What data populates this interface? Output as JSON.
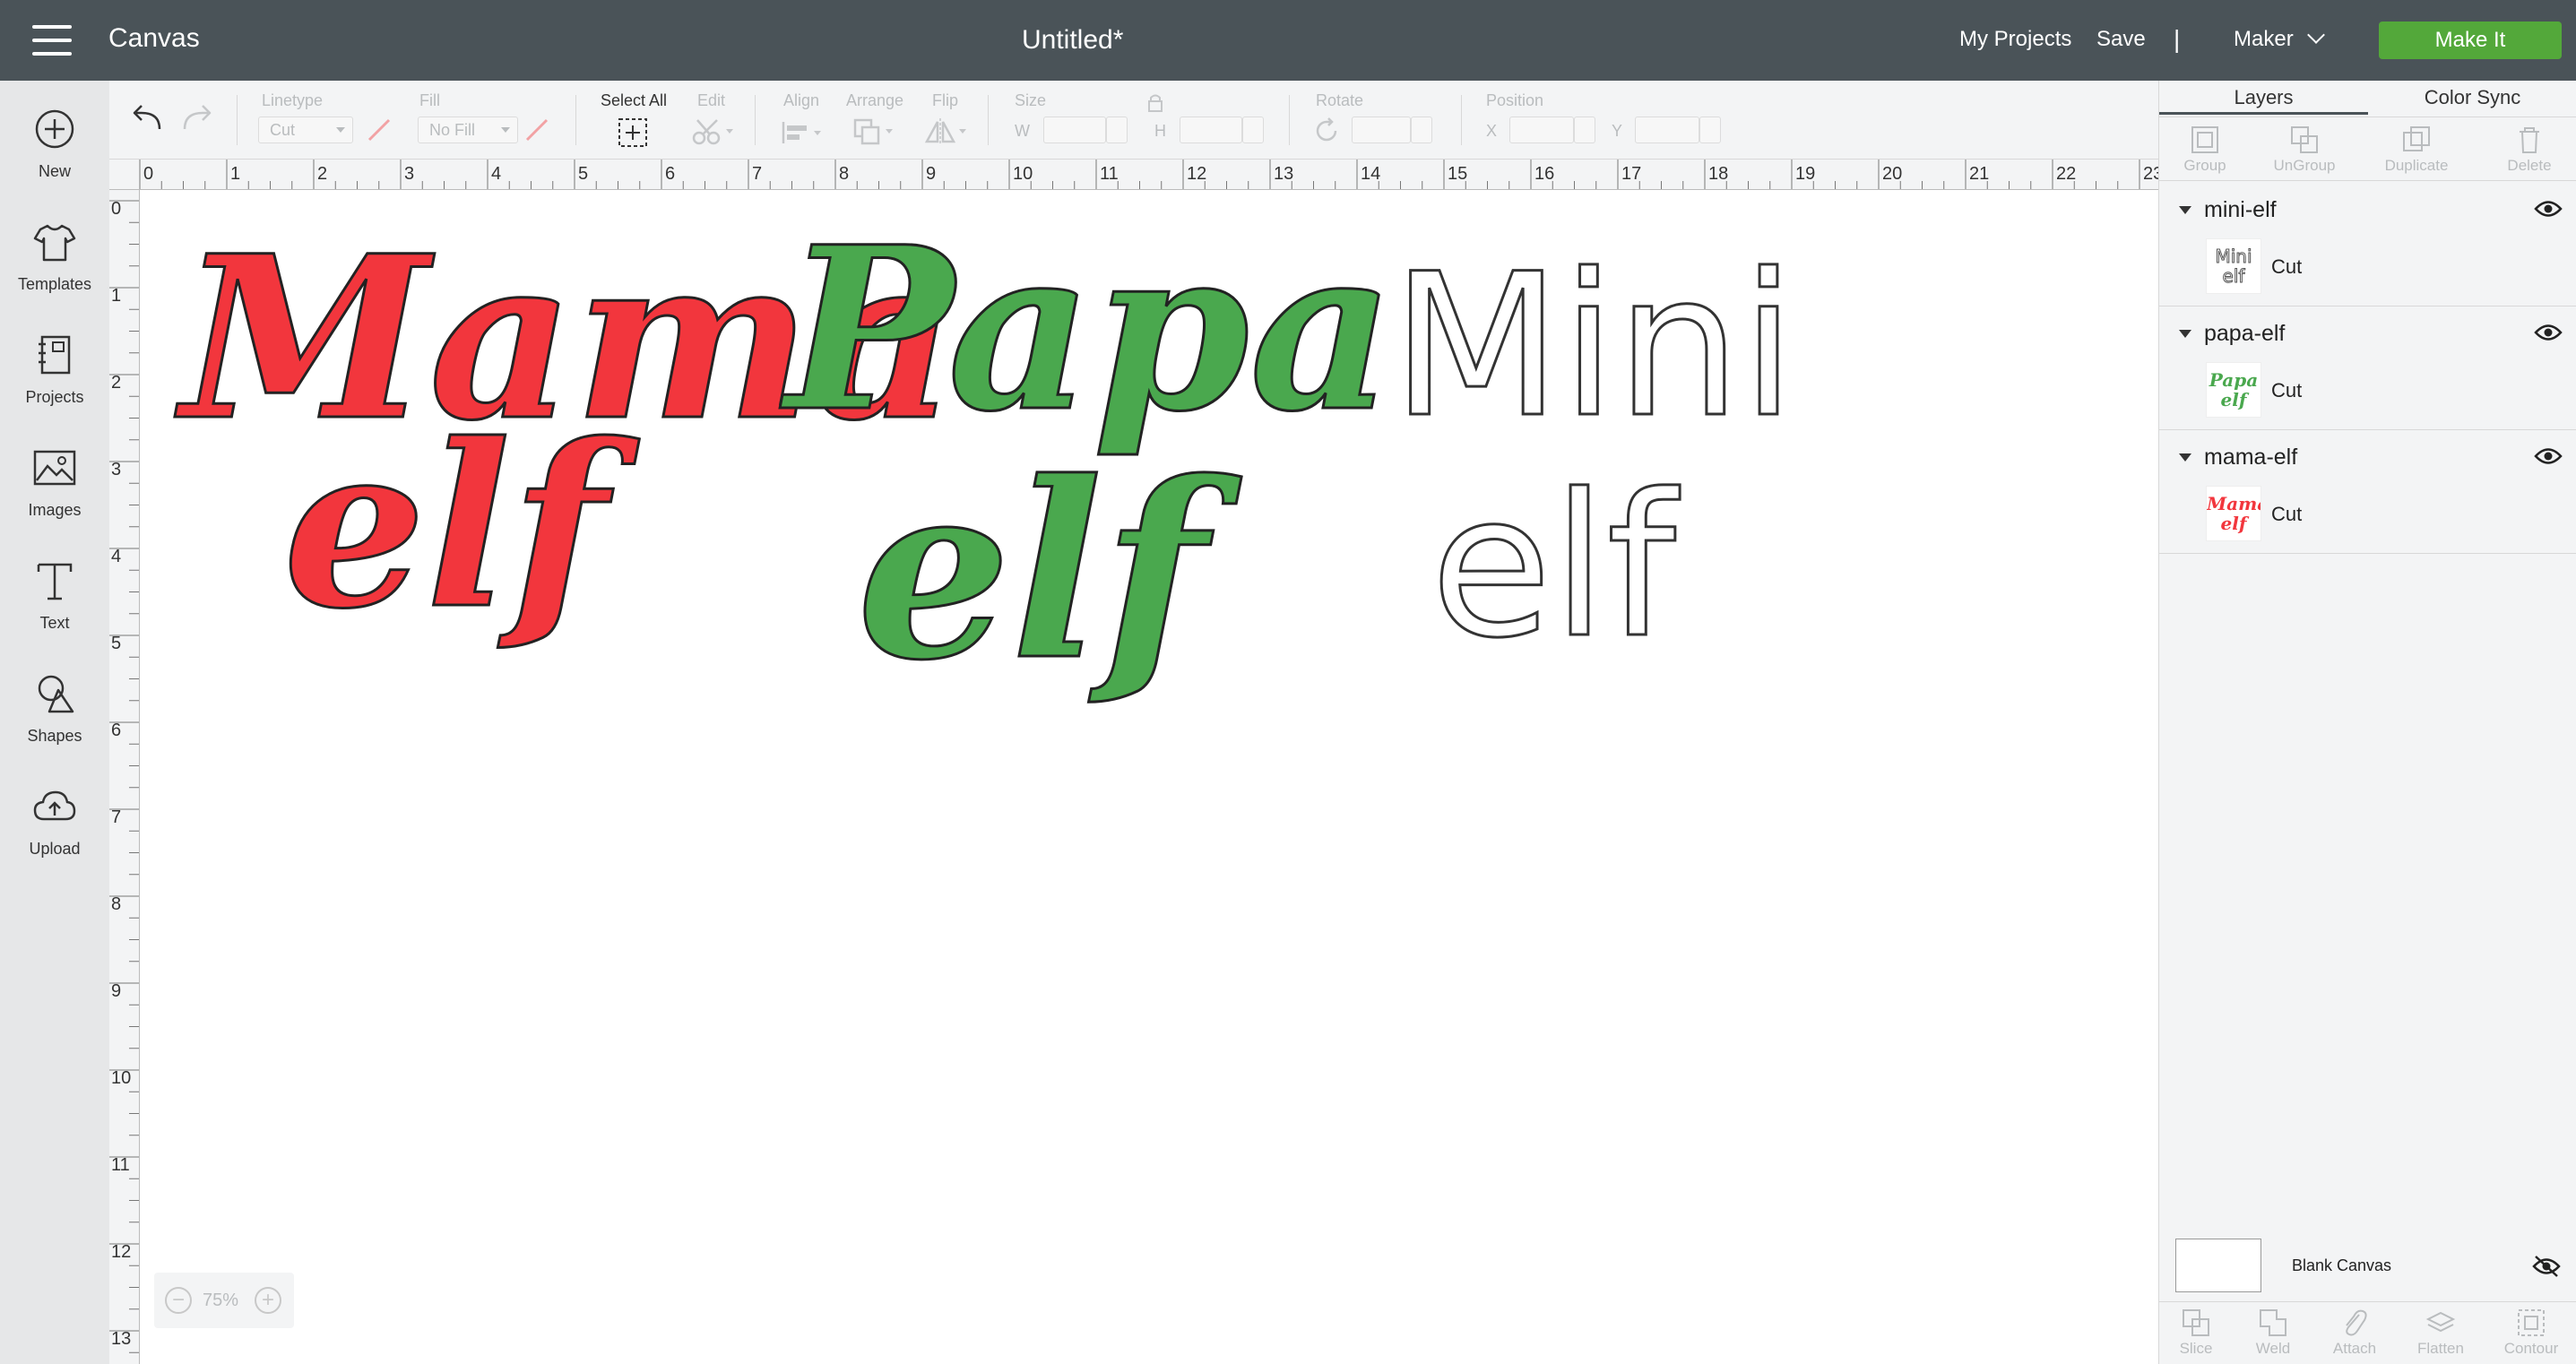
{
  "header": {
    "app_title": "Canvas",
    "doc_title": "Untitled*",
    "my_projects": "My Projects",
    "save": "Save",
    "separator": "|",
    "machine": "Maker",
    "make_it": "Make It"
  },
  "leftnav": {
    "items": [
      {
        "label": "New",
        "icon": "plus-circle-icon"
      },
      {
        "label": "Templates",
        "icon": "tshirt-icon"
      },
      {
        "label": "Projects",
        "icon": "notebook-icon"
      },
      {
        "label": "Images",
        "icon": "image-icon"
      },
      {
        "label": "Text",
        "icon": "text-t-icon"
      },
      {
        "label": "Shapes",
        "icon": "shapes-icon"
      },
      {
        "label": "Upload",
        "icon": "cloud-upload-icon"
      }
    ]
  },
  "toolbar": {
    "linetype_label": "Linetype",
    "linetype_value": "Cut",
    "fill_label": "Fill",
    "fill_value": "No Fill",
    "select_all_label": "Select All",
    "edit_label": "Edit",
    "align_label": "Align",
    "arrange_label": "Arrange",
    "flip_label": "Flip",
    "size_label": "Size",
    "w_label": "W",
    "h_label": "H",
    "rotate_label": "Rotate",
    "position_label": "Position",
    "x_label": "X",
    "y_label": "Y"
  },
  "ruler": {
    "top": [
      "0",
      "1",
      "2",
      "3",
      "4",
      "5",
      "6",
      "7",
      "8",
      "9",
      "10",
      "11",
      "12",
      "13",
      "14",
      "15",
      "16",
      "17",
      "18",
      "19",
      "20",
      "21",
      "22",
      "23"
    ],
    "left": [
      "0",
      "1",
      "2",
      "3",
      "4",
      "5",
      "6",
      "7",
      "8",
      "9",
      "10",
      "11",
      "12",
      "13"
    ]
  },
  "canvas": {
    "designs": {
      "mama_line1": "Mama",
      "mama_line2": "elf",
      "papa_line1": "Papa",
      "papa_line2": "elf",
      "mini_line1": "Mini",
      "mini_line2": "elf"
    },
    "colors": {
      "red": "#f2363d",
      "green": "#4aa84e",
      "outline": "#333333"
    },
    "zoom": {
      "minus": "−",
      "value": "75%",
      "plus": "+"
    }
  },
  "rpanel": {
    "tabs": [
      "Layers",
      "Color Sync"
    ],
    "actions": [
      "Group",
      "UnGroup",
      "Duplicate",
      "Delete"
    ],
    "layers": [
      {
        "name": "mini-elf",
        "operation": "Cut",
        "thumb_line1": "Mini",
        "thumb_line2": "elf",
        "thumb_color": "#ffffff"
      },
      {
        "name": "papa-elf",
        "operation": "Cut",
        "thumb_line1": "Papa",
        "thumb_line2": "elf",
        "thumb_color": "#4aa84e"
      },
      {
        "name": "mama-elf",
        "operation": "Cut",
        "thumb_line1": "Mama",
        "thumb_line2": "elf",
        "thumb_color": "#f2363d"
      }
    ],
    "blank_canvas": "Blank Canvas",
    "bottom_actions": [
      "Slice",
      "Weld",
      "Attach",
      "Flatten",
      "Contour"
    ]
  }
}
